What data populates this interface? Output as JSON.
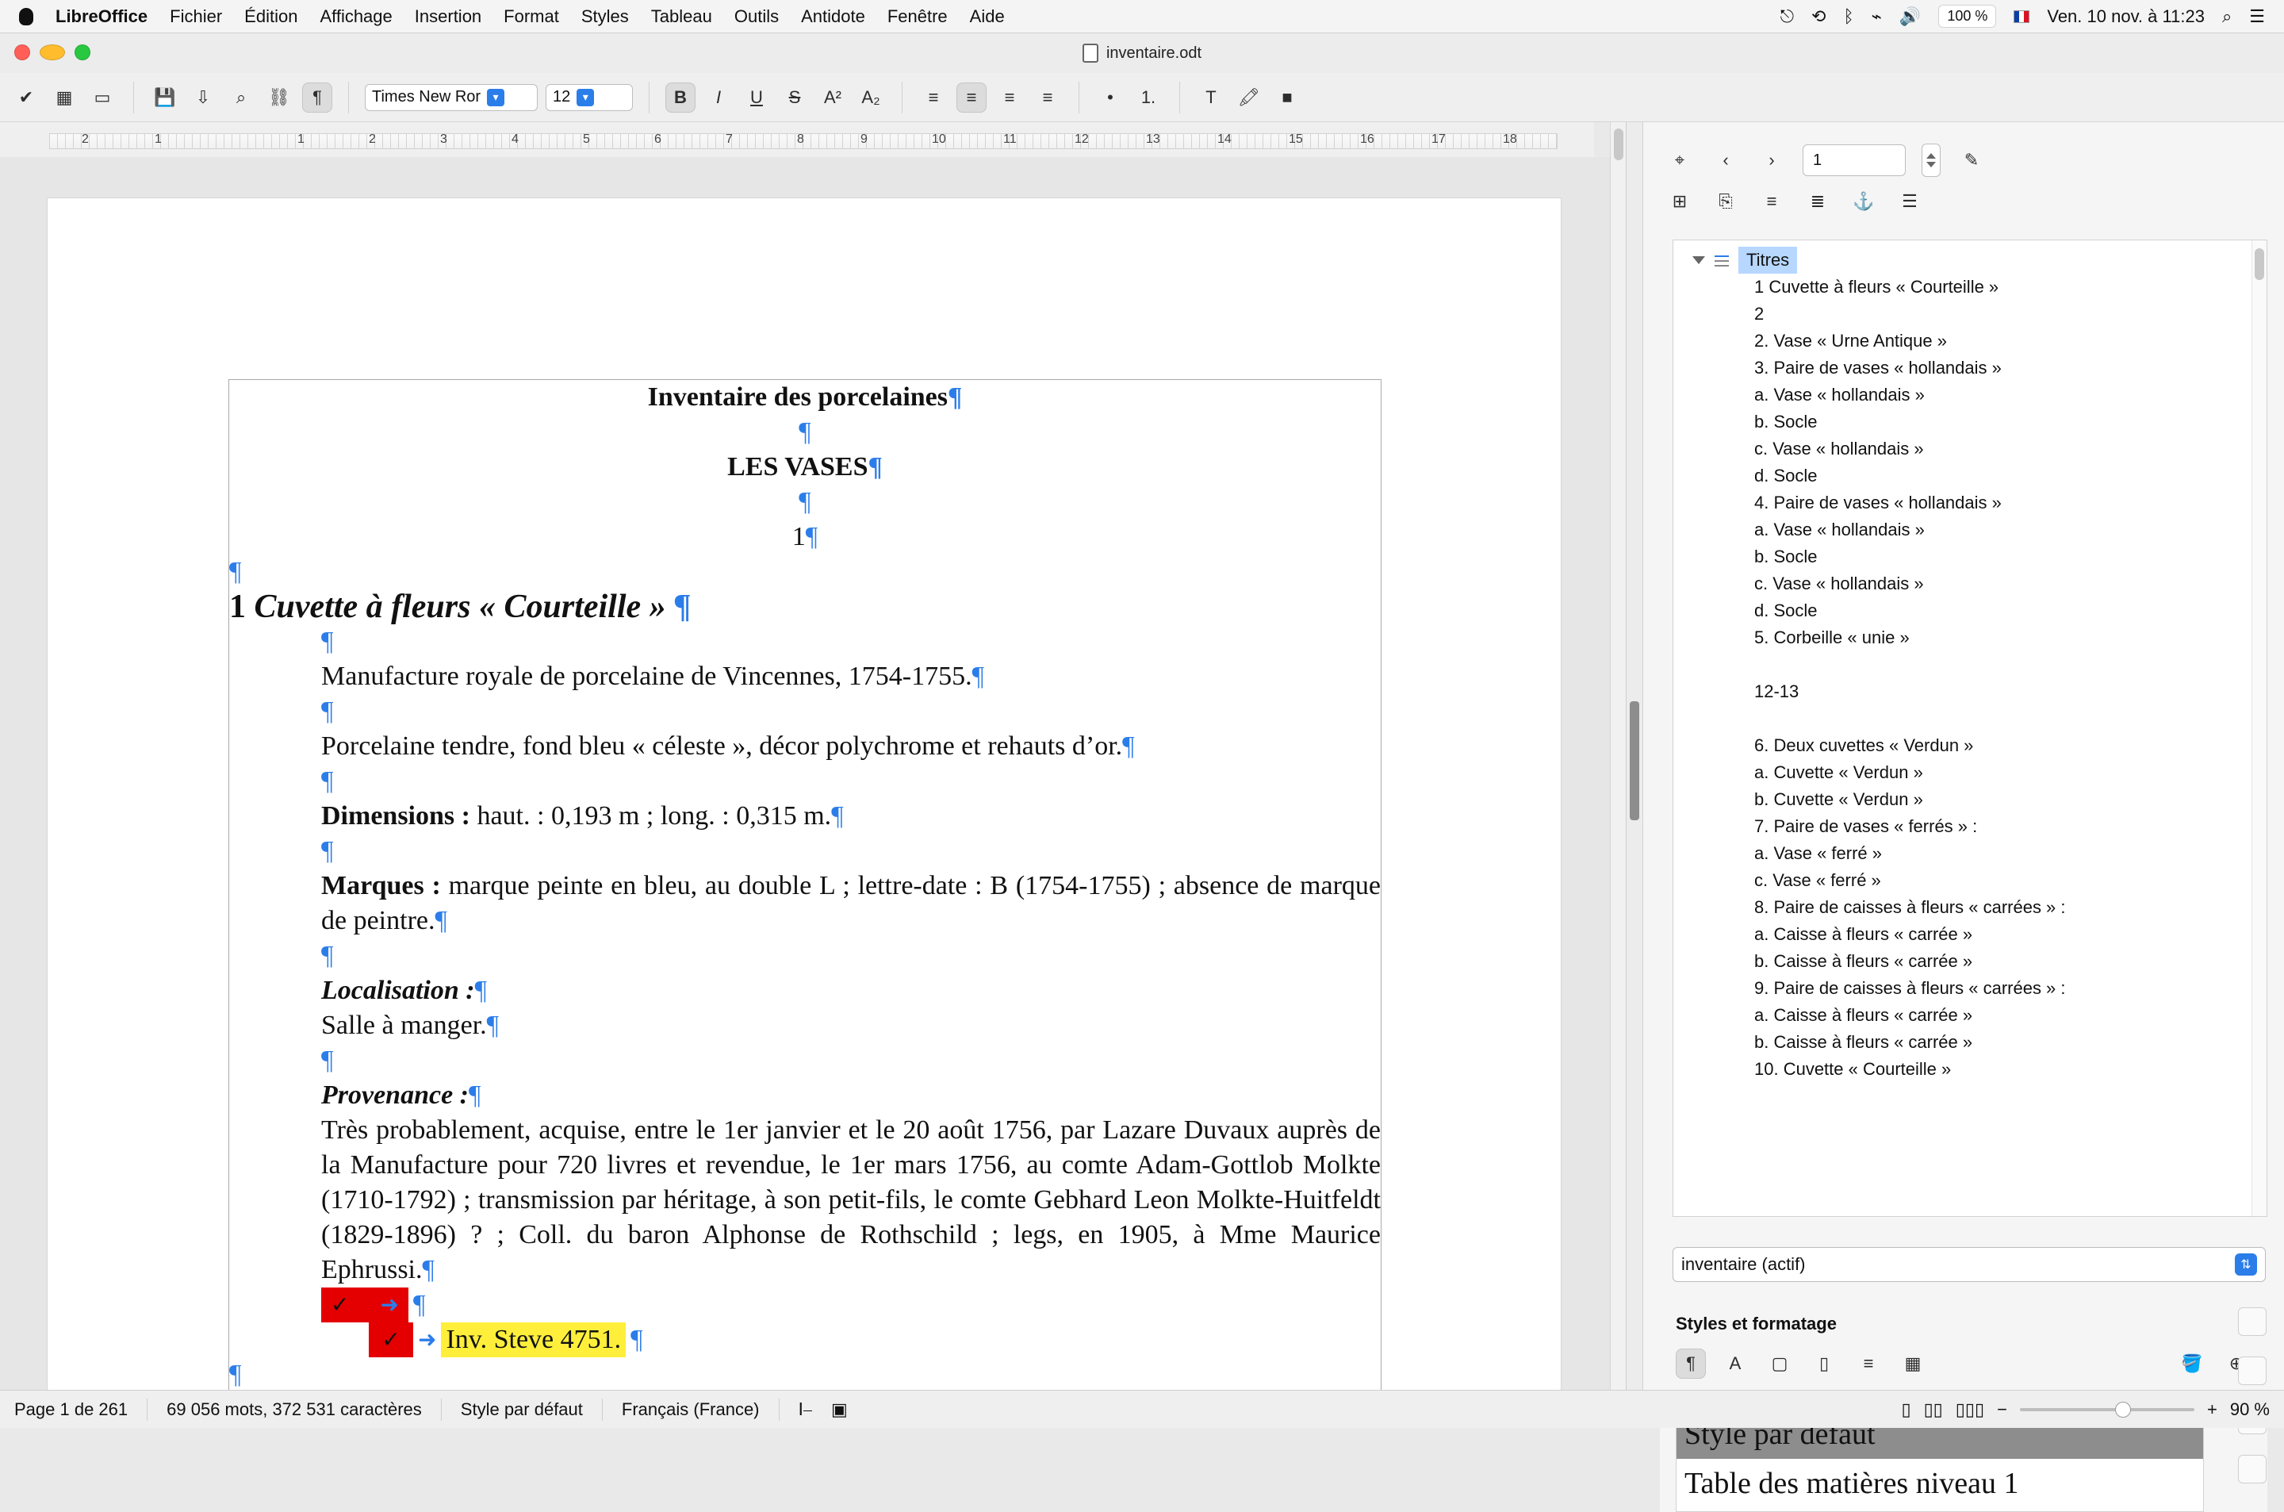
{
  "menubar": {
    "app": "LibreOffice",
    "items": [
      "Fichier",
      "Édition",
      "Affichage",
      "Insertion",
      "Format",
      "Styles",
      "Tableau",
      "Outils",
      "Antidote",
      "Fenêtre",
      "Aide"
    ],
    "status": {
      "battery": "100 %",
      "datetime": "Ven. 10 nov. à 11:23"
    }
  },
  "window": {
    "title": "inventaire.odt"
  },
  "toolbar": {
    "font_name": "Times New Ror",
    "font_size": "12"
  },
  "ruler": {
    "numbers": [
      "2",
      "1",
      "1",
      "2",
      "3",
      "4",
      "5",
      "6",
      "7",
      "8",
      "9",
      "10",
      "11",
      "12",
      "13",
      "14",
      "15",
      "16",
      "17",
      "18"
    ]
  },
  "document": {
    "title": "Inventaire des porcelaines",
    "section": "LES VASES",
    "page_marker": "1",
    "heading_number": "1",
    "heading_text": "Cuvette à fleurs « Courteille »",
    "p1": "Manufacture royale de porcelaine de Vincennes, 1754-1755.",
    "p2": "Porcelaine tendre, fond bleu « céleste », décor polychrome et rehauts d’or.",
    "dimensions_label": "Dimensions :",
    "dimensions_text": " haut. : 0,193 m ; long. : 0,315 m.",
    "marks_label": "Marques :",
    "marks_text": " marque peinte en bleu, au double L ; lettre-date : B (1754-1755) ; absence de marque de peintre.",
    "localisation_label": "Localisation :",
    "localisation_value": "Salle à manger.",
    "provenance_label": "Provenance :",
    "provenance_text": "Très probablement, acquise, entre le 1er janvier et le 20 août 1756, par Lazare Duvaux auprès de la Manufacture pour 720 livres et revendue, le 1er mars 1756, au comte Adam-Gottlob Molkte (1710-1792) ; transmission par héritage, à son petit-fils, le comte Gebhard Leon Molkte-Huitfeldt (1829-1896) ? ; Coll. du baron Alphonse de Rothschild ; legs, en 1905, à Mme Maurice Ephrussi.",
    "inv_text": "Inv. Steve 4751."
  },
  "sidebar": {
    "navigator": {
      "page_input": "1",
      "root_label": "Titres",
      "titles": [
        "1 Cuvette à fleurs « Courteille »",
        "2",
        "2. Vase « Urne Antique »",
        "3. Paire de vases « hollandais »",
        "a. Vase « hollandais »",
        "b. Socle",
        "c. Vase « hollandais »",
        "d. Socle",
        "4. Paire de vases « hollandais »",
        "a. Vase « hollandais »",
        "b. Socle",
        "c. Vase « hollandais »",
        "d. Socle",
        "5. Corbeille « unie »",
        "",
        "12-13",
        "",
        "6. Deux cuvettes « Verdun »",
        "a. Cuvette « Verdun »",
        "b. Cuvette « Verdun »",
        "7. Paire de vases « ferrés » :",
        "a. Vase « ferré »",
        "c. Vase « ferré »",
        "8. Paire de caisses à fleurs « carrées » :",
        "a. Caisse à fleurs « carrée »",
        "b. Caisse à  fleurs « carrée »",
        "9. Paire de caisses à fleurs « carrées » :",
        "a. Caisse à fleurs « carrée »",
        "b. Caisse à  fleurs « carrée »",
        "10. Cuvette « Courteille »"
      ]
    },
    "document_select": "inventaire (actif)",
    "styles": {
      "title": "Styles et formatage",
      "items": [
        "Style par défaut",
        "Table des matières niveau 1"
      ]
    }
  },
  "status": {
    "page": "Page 1 de 261",
    "words": "69 056 mots, 372 531 caractères",
    "style": "Style par défaut",
    "language": "Français (France)",
    "zoom": "90 %"
  },
  "colors": {
    "accent": "#2b7de9",
    "pilcrow": "#2b7de9",
    "highlight_yellow": "#ffef3b",
    "highlight_red": "#e40000",
    "selection_bg": "#b7d7ff"
  }
}
